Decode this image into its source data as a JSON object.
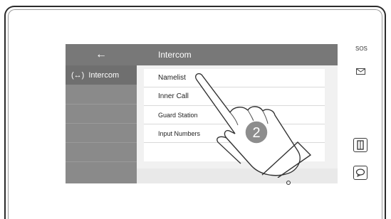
{
  "screen": {
    "back_label": "←",
    "title": "Intercom"
  },
  "sidebar": {
    "items": [
      {
        "label": "Intercom",
        "icon": "intercom-icon"
      }
    ]
  },
  "menu": {
    "items": [
      {
        "label": "Namelist"
      },
      {
        "label": "Inner Call"
      },
      {
        "label": "Guard Station"
      },
      {
        "label": "Input Numbers"
      }
    ]
  },
  "device": {
    "sos_label": "SOS",
    "message_icon": "envelope-icon",
    "unlock_icon": "door-icon",
    "monitor_icon": "chat-icon"
  },
  "overlay": {
    "step_number": "2",
    "pointer": "hand-pointer-icon"
  },
  "colors": {
    "topbar": "#787878",
    "sidebar": "#8a8a8a",
    "sidebar_active": "#6f6f6f",
    "badge": "#8d8d8d"
  }
}
